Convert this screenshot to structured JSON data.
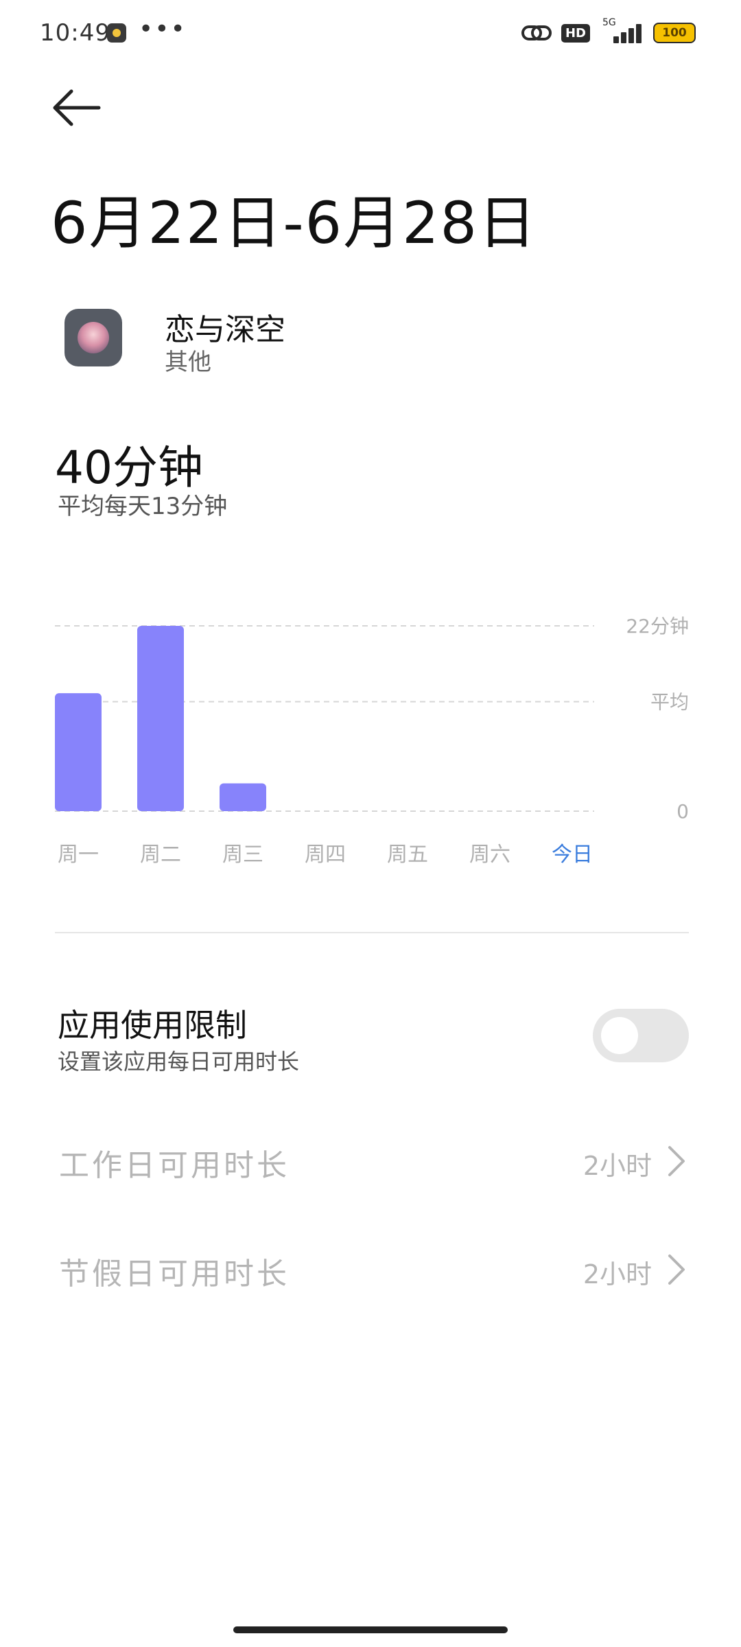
{
  "status_bar": {
    "time": "10:49",
    "more": "•••",
    "hd": "HD",
    "network": "5G",
    "battery": "100"
  },
  "header": {
    "date_range": "6月22日-6月28日"
  },
  "app": {
    "name": "恋与深空",
    "category": "其他"
  },
  "usage": {
    "total": "40分钟",
    "average": "平均每天13分钟"
  },
  "chart_data": {
    "type": "bar",
    "categories": [
      "周一",
      "周二",
      "周三",
      "周四",
      "周五",
      "周六",
      "今日"
    ],
    "values": [
      14,
      22,
      3.3,
      0,
      0,
      0,
      0
    ],
    "unit": "分钟",
    "ylim": [
      0,
      22
    ],
    "y_tick_labels": [
      "22分钟",
      "平均",
      "0"
    ],
    "average_value": 13,
    "highlight_category": "今日",
    "bar_color": "#8783fb",
    "highlight_color": "#3b7ddd",
    "grid": "dashed"
  },
  "limit": {
    "title": "应用使用限制",
    "description": "设置该应用每日可用时长",
    "enabled": false
  },
  "rows": [
    {
      "label": "工作日可用时长",
      "value": "2小时"
    },
    {
      "label": "节假日可用时长",
      "value": "2小时"
    }
  ]
}
